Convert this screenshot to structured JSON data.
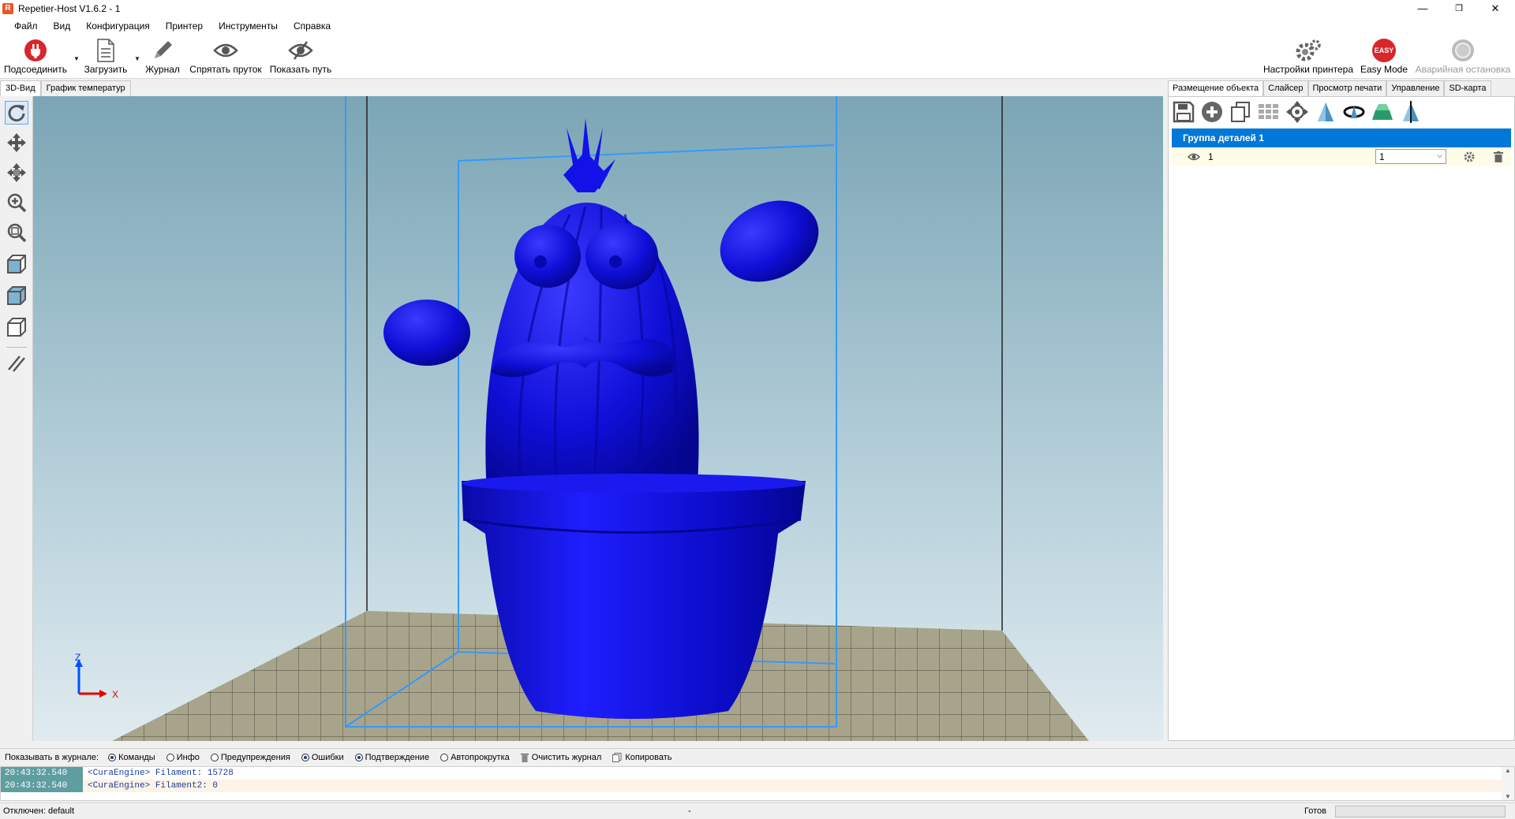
{
  "window": {
    "title": "Repetier-Host V1.6.2 - 1",
    "app_icon": "R",
    "minimize": "—",
    "maximize": "❐",
    "close": "✕"
  },
  "menu": [
    "Файл",
    "Вид",
    "Конфигурация",
    "Принтер",
    "Инструменты",
    "Справка"
  ],
  "toolbar": {
    "connect": "Подсоединить",
    "load": "Загрузить",
    "log": "Журнал",
    "hide_filament": "Спрятать пруток",
    "show_path": "Показать путь",
    "printer_settings": "Настройки принтера",
    "easy_mode": "Easy Mode",
    "easy_badge": "EASY",
    "emergency_stop": "Аварийная остановка"
  },
  "left_tabs": [
    "3D-Вид",
    "График температур"
  ],
  "right_tabs": [
    "Размещение объекта",
    "Слайсер",
    "Просмотр печати",
    "Управление",
    "SD-карта"
  ],
  "object_panel": {
    "group_label": "Группа деталей 1",
    "object_name": "1",
    "object_select_value": "1"
  },
  "axis": {
    "z": "Z",
    "x": "X"
  },
  "log_bar": {
    "label": "Показывать в журнале:",
    "commands": "Команды",
    "info": "Инфо",
    "warnings": "Предупреждения",
    "errors": "Ошибки",
    "ack": "Подтверждение",
    "autoscroll": "Автопрокрутка",
    "clear": "Очистить журнал",
    "copy": "Копировать"
  },
  "log_entries": [
    {
      "time": "20:43:32.540",
      "msg": "<CuraEngine> Filament: 15728"
    },
    {
      "time": "20:43:32.540",
      "msg": "<CuraEngine> Filament2: 0"
    }
  ],
  "status": {
    "left": "Отключен: default",
    "center": "-",
    "right": "Готов"
  },
  "colors": {
    "model": "#1010dd",
    "accent": "#0078d7",
    "build_box": "#3399ff"
  }
}
